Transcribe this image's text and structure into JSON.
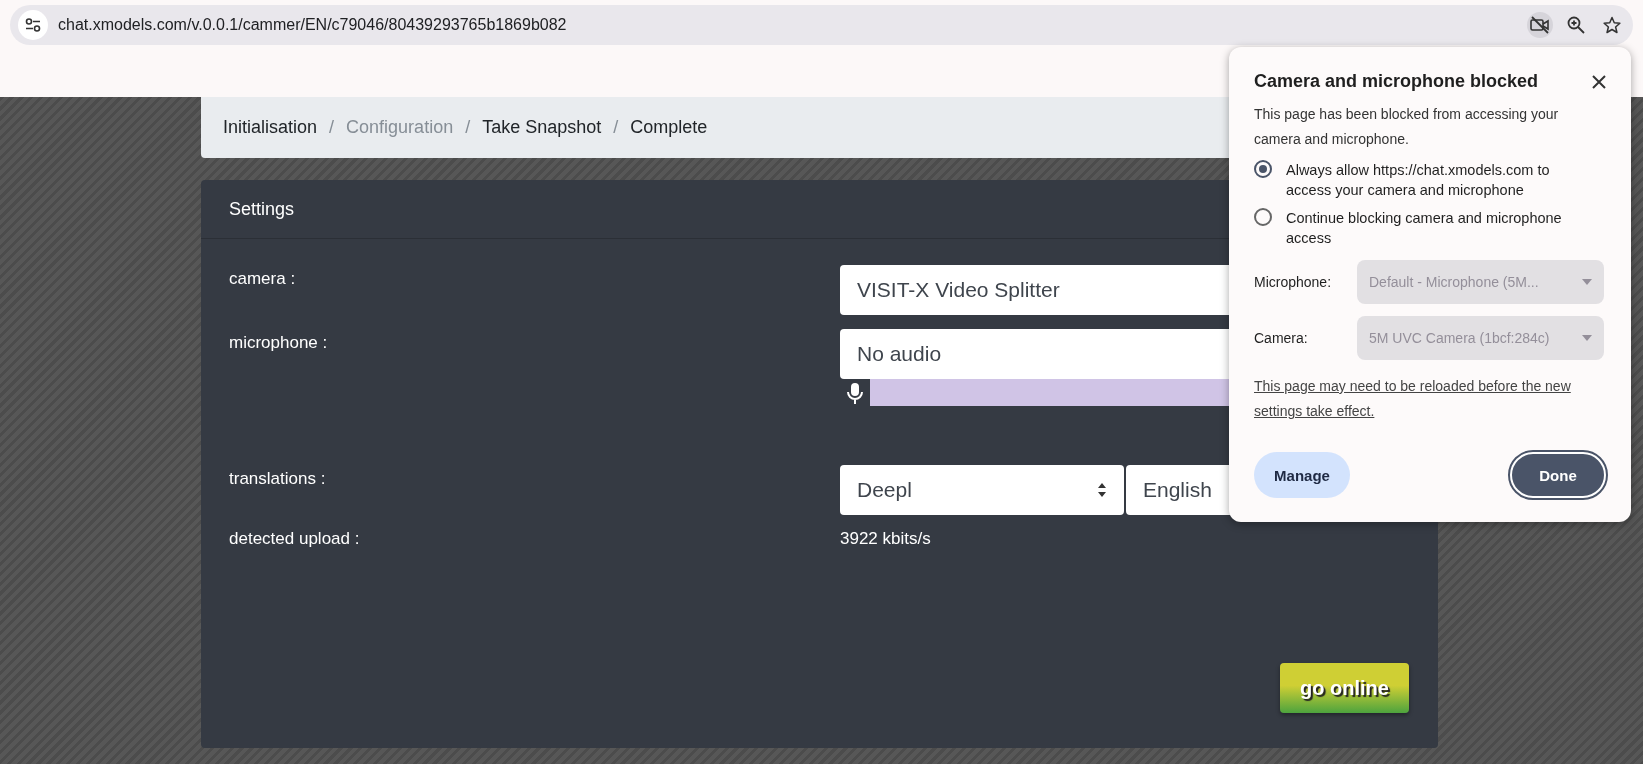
{
  "browser": {
    "url": "chat.xmodels.com/v.0.0.1/cammer/EN/c79046/80439293765b1869b082"
  },
  "breadcrumb": [
    {
      "label": "Initialisation",
      "disabled": false
    },
    {
      "separator": "/",
      "label": "Configuration",
      "disabled": true
    },
    {
      "separator": "/",
      "label": "Take Snapshot",
      "disabled": false
    },
    {
      "separator": "/",
      "label": "Complete",
      "disabled": false
    }
  ],
  "settings": {
    "title": "Settings",
    "camera": {
      "label": "camera :",
      "value": "VISIT-X Video Splitter"
    },
    "microphone": {
      "label": "microphone :",
      "value": "No audio"
    },
    "translations": {
      "label": "translations :",
      "service": "Deepl",
      "language": "English"
    },
    "upload": {
      "label": "detected upload :",
      "value": "3922 kbits/s"
    },
    "button": "go online"
  },
  "popup": {
    "title": "Camera and microphone blocked",
    "message": "This page has been blocked from accessing your camera and microphone.",
    "options": [
      {
        "label": "Always allow https://chat.xmodels.com to access your camera and microphone",
        "selected": true
      },
      {
        "label": "Continue blocking camera and microphone access",
        "selected": false
      }
    ],
    "devices": [
      {
        "label": "Microphone:",
        "value": "Default - Microphone (5M...",
        "disabled": true
      },
      {
        "label": "Camera:",
        "value": "5M UVC Camera (1bcf:284c)",
        "disabled": true
      }
    ],
    "note": "This page may need to be reloaded before the new settings take effect.",
    "buttons": {
      "manage": "Manage",
      "done": "Done"
    }
  }
}
